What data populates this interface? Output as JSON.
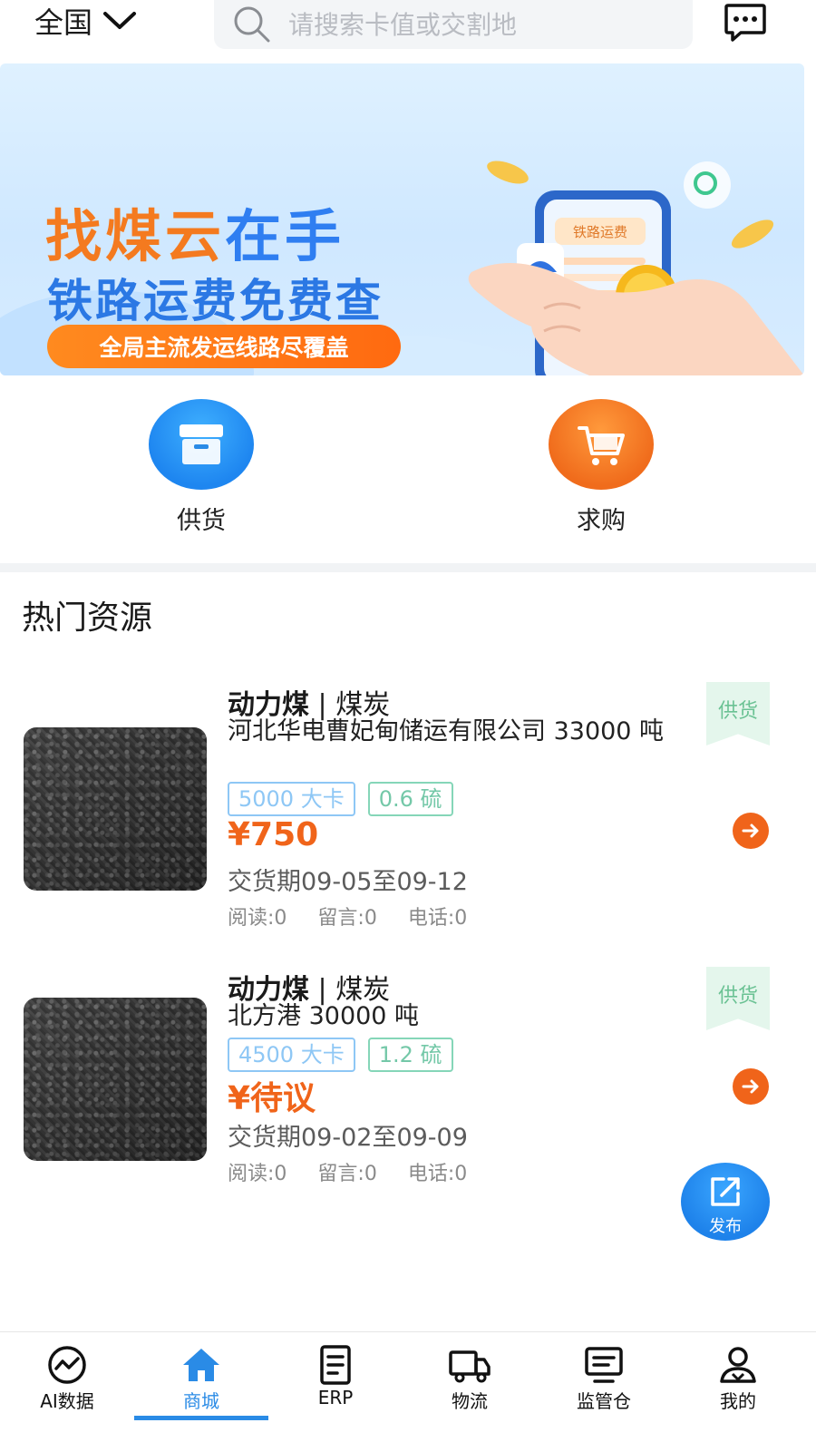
{
  "header": {
    "region": "全国",
    "search_placeholder": "请搜索卡值或交割地"
  },
  "banner": {
    "title_part1": "找煤云",
    "title_part2": "在手",
    "subtitle": "铁路运费免费查",
    "pill": "全局主流发运线路尽覆盖",
    "phone_label": "铁路运费",
    "slides": 3,
    "active_slide": 1
  },
  "quick_entries": {
    "supply": "供货",
    "buy": "求购"
  },
  "section_title": "热门资源",
  "listings": [
    {
      "product": "动力煤",
      "category": "| 煤炭",
      "company": "河北华电曹妃甸储运有限公司 33000 吨",
      "tag_calorific": "5000 大卡",
      "tag_sulfur": "0.6 硫",
      "price": "¥750",
      "period": "交货期09-05至09-12",
      "reads": "阅读:0",
      "messages": "留言:0",
      "calls": "电话:0",
      "badge": "供货"
    },
    {
      "product": "动力煤",
      "category": "| 煤炭",
      "company": "北方港 30000 吨",
      "tag_calorific": "4500 大卡",
      "tag_sulfur": "1.2 硫",
      "price": "¥待议",
      "period": "交货期09-02至09-09",
      "reads": "阅读:0",
      "messages": "留言:0",
      "calls": "电话:0",
      "badge": "供货"
    }
  ],
  "fab": {
    "label": "发布"
  },
  "bottom_nav": [
    {
      "label": "AI数据",
      "icon": "chart-circle-icon"
    },
    {
      "label": "商城",
      "icon": "home-icon",
      "active": true
    },
    {
      "label": "ERP",
      "icon": "document-icon"
    },
    {
      "label": "物流",
      "icon": "truck-icon"
    },
    {
      "label": "监管仓",
      "icon": "monitor-icon"
    },
    {
      "label": "我的",
      "icon": "user-icon"
    }
  ],
  "colors": {
    "accent_blue": "#2a8be6",
    "price_orange": "#f0641a",
    "badge_green": "#6bc294"
  }
}
